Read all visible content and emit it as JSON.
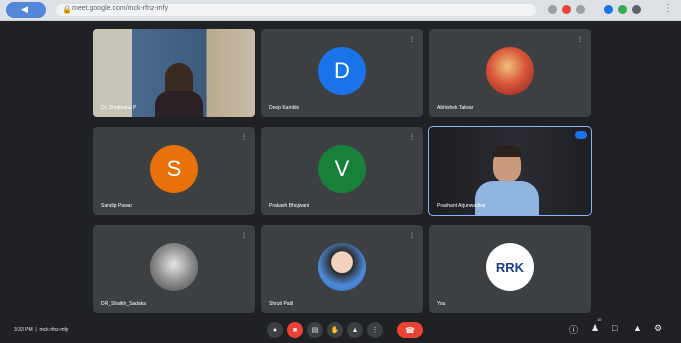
{
  "browser": {
    "url": "meet.google.com/mck-rfnz-mfy",
    "lock_icon": "lock-icon"
  },
  "tiles": [
    {
      "name": "Dr. Shobhana P",
      "type": "video",
      "muted": false
    },
    {
      "name": "Deep Kamble",
      "type": "avatar",
      "initial": "D",
      "color": "#1a73e8",
      "muted": true
    },
    {
      "name": "Abhishek Talwar",
      "type": "photo",
      "muted": true
    },
    {
      "name": "Sandip Pawar",
      "type": "avatar",
      "initial": "S",
      "color": "#e8710a",
      "muted": true
    },
    {
      "name": "Prakash Bhojwani",
      "type": "avatar",
      "initial": "V",
      "color": "#188038",
      "muted": true
    },
    {
      "name": "Prashant Arjunwadkar",
      "type": "video",
      "muted": false,
      "active": true
    },
    {
      "name": "DR_Shaikh_Sadaka",
      "type": "photo",
      "muted": true
    },
    {
      "name": "Shruti Patil",
      "type": "photo",
      "muted": true
    },
    {
      "name": "You",
      "type": "logo",
      "logo_text": "RRK",
      "muted": false
    }
  ],
  "toolbar": {
    "time": "3:33 PM",
    "meeting_code": "mck-rfnz-mfy",
    "participant_count": "10",
    "mic_icon": "mic-icon",
    "cam_icon": "camera-off-icon",
    "cc_icon": "captions-icon",
    "hand_icon": "raise-hand-icon",
    "present_icon": "present-icon",
    "more_icon": "more-options-icon",
    "end_icon": "end-call-icon"
  }
}
